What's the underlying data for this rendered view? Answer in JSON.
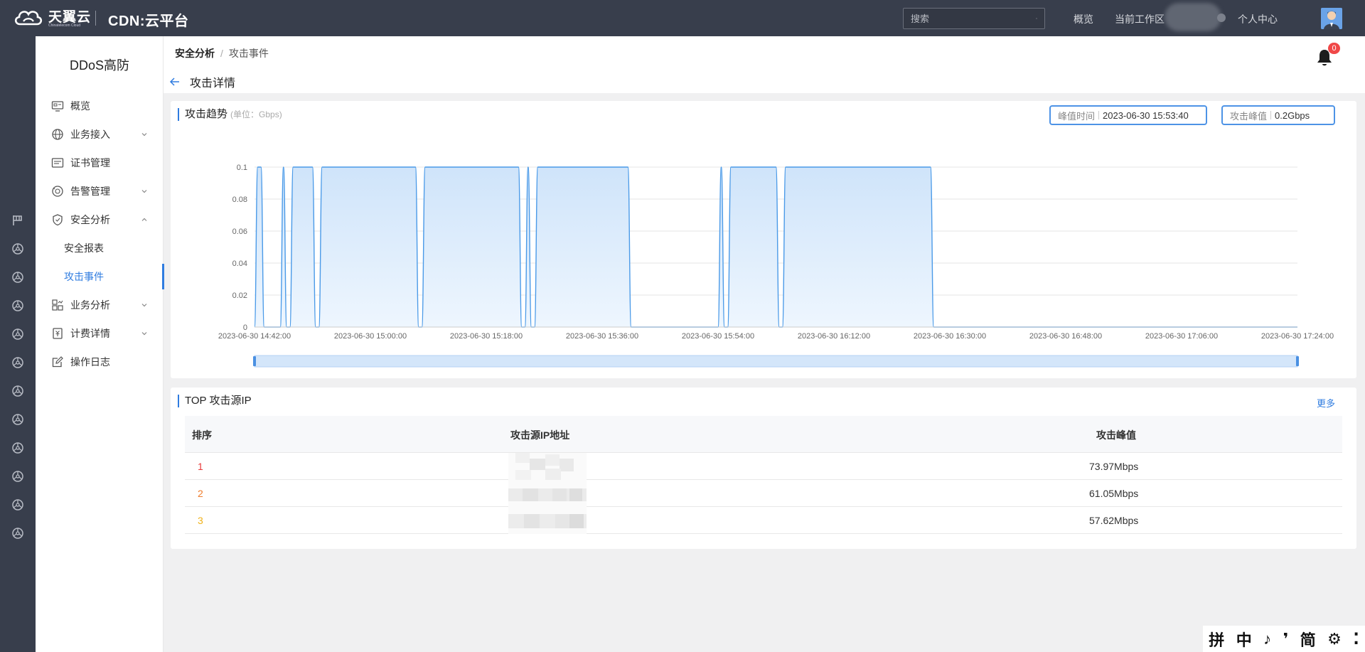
{
  "header": {
    "brand": "天翼云",
    "brand_sub": "Chinatelecom Cloud",
    "product": "CDN:云平台",
    "search_placeholder": "搜索",
    "nav_overview": "概览",
    "nav_workspace": "当前工作区",
    "nav_user_center": "个人中心"
  },
  "sidebar": {
    "title": "DDoS高防",
    "items": [
      {
        "label": "概览"
      },
      {
        "label": "业务接入"
      },
      {
        "label": "证书管理"
      },
      {
        "label": "告警管理"
      },
      {
        "label": "安全分析"
      },
      {
        "label": "业务分析"
      },
      {
        "label": "计费详情"
      },
      {
        "label": "操作日志"
      }
    ],
    "sub_items": [
      {
        "label": "安全报表"
      },
      {
        "label": "攻击事件"
      }
    ]
  },
  "breadcrumb": {
    "first": "安全分析",
    "sep": "/",
    "second": "攻击事件"
  },
  "page_title": "攻击详情",
  "notifications": {
    "count": "0"
  },
  "trend_panel": {
    "title": "攻击趋势",
    "unit": "(单位：Gbps)",
    "peak_time_label": "峰值时间",
    "peak_time_value": "2023-06-30 15:53:40",
    "peak_value_label": "攻击峰值",
    "peak_value_value": "0.2Gbps"
  },
  "chart_data": {
    "type": "area",
    "title": "",
    "xlabel": "",
    "ylabel": "",
    "ylim": [
      0,
      0.1
    ],
    "yticks": [
      "0",
      "0.02",
      "0.04",
      "0.06",
      "0.08",
      "0.1"
    ],
    "xticks": [
      "2023-06-30 14:42:00",
      "2023-06-30 15:00:00",
      "2023-06-30 15:18:00",
      "2023-06-30 15:36:00",
      "2023-06-30 15:54:00",
      "2023-06-30 16:12:00",
      "2023-06-30 16:30:00",
      "2023-06-30 16:48:00",
      "2023-06-30 17:06:00",
      "2023-06-30 17:24:00"
    ],
    "grid": true,
    "color": "#4a9ae8",
    "series": [
      {
        "x": [
          "2023-06-30 14:42:00",
          "2023-06-30 14:42:30",
          "2023-06-30 14:43:00",
          "2023-06-30 14:43:30",
          "2023-06-30 14:44:00",
          "2023-06-30 14:46:00",
          "2023-06-30 14:46:30",
          "2023-06-30 14:47:00",
          "2023-06-30 14:47:30",
          "2023-06-30 14:48:00",
          "2023-06-30 14:48:30",
          "2023-06-30 14:51:00",
          "2023-06-30 14:51:30",
          "2023-06-30 14:52:00",
          "2023-06-30 14:52:30",
          "2023-06-30 14:53:00",
          "2023-06-30 15:07:00",
          "2023-06-30 15:07:30",
          "2023-06-30 15:08:00",
          "2023-06-30 15:08:30",
          "2023-06-30 15:09:00",
          "2023-06-30 15:23:00",
          "2023-06-30 15:23:30",
          "2023-06-30 15:24:00",
          "2023-06-30 15:24:30",
          "2023-06-30 15:25:00",
          "2023-06-30 15:25:30",
          "2023-06-30 15:26:00",
          "2023-06-30 15:26:30",
          "2023-06-30 15:27:00",
          "2023-06-30 15:40:00",
          "2023-06-30 15:40:30",
          "2023-06-30 15:41:00",
          "2023-06-30 15:54:00",
          "2023-06-30 15:54:30",
          "2023-06-30 15:55:00",
          "2023-06-30 15:55:30",
          "2023-06-30 15:56:00",
          "2023-06-30 15:56:30",
          "2023-06-30 15:57:00",
          "2023-06-30 16:03:00",
          "2023-06-30 16:03:30",
          "2023-06-30 16:04:00",
          "2023-06-30 16:04:30",
          "2023-06-30 16:05:00",
          "2023-06-30 16:27:00",
          "2023-06-30 16:27:30",
          "2023-06-30 16:28:00",
          "2023-06-30 17:24:00"
        ],
        "values": [
          0,
          0.1,
          0.1,
          0,
          0,
          0,
          0.1,
          0,
          0,
          0.1,
          0.1,
          0.1,
          0,
          0,
          0.1,
          0.1,
          0.1,
          0,
          0,
          0.1,
          0.1,
          0.1,
          0,
          0,
          0.1,
          0,
          0,
          0.1,
          0.1,
          0.1,
          0.1,
          0,
          0,
          0,
          0.1,
          0,
          0,
          0.1,
          0.1,
          0.1,
          0.1,
          0,
          0,
          0.1,
          0.1,
          0.1,
          0,
          0,
          0
        ]
      }
    ]
  },
  "top_ip_panel": {
    "title": "TOP 攻击源IP",
    "more": "更多",
    "columns": [
      "排序",
      "攻击源IP地址",
      "攻击峰值"
    ],
    "rows": [
      {
        "rank": "1",
        "peak": "73.97Mbps"
      },
      {
        "rank": "2",
        "peak": "61.05Mbps"
      },
      {
        "rank": "3",
        "peak": "57.62Mbps"
      }
    ]
  },
  "ime": {
    "items": [
      "拼",
      "中",
      "♪",
      "❜",
      "简",
      "⚙",
      "⁚"
    ]
  }
}
